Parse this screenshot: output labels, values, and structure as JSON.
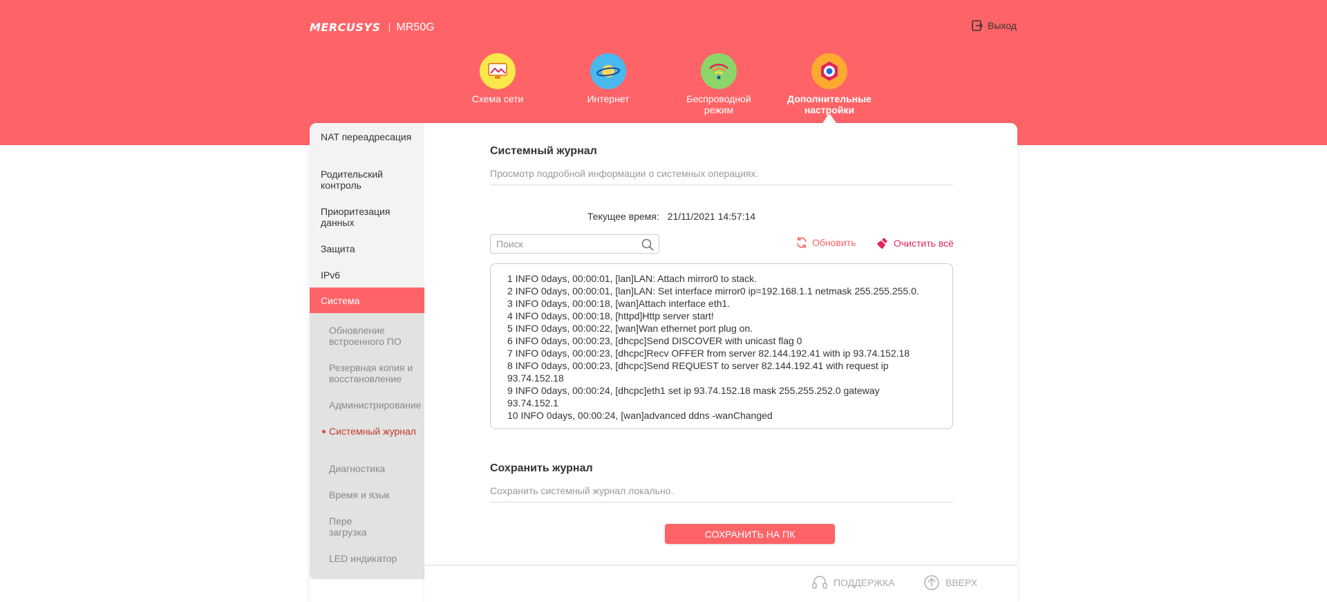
{
  "header": {
    "brand": "MERCUSYS",
    "model": "MR50G",
    "logout_label": "Выход"
  },
  "nav": {
    "items": [
      {
        "label": "Схема сети",
        "icon": "network-map-icon",
        "color": "#fce84b"
      },
      {
        "label": "Интернет",
        "icon": "planet-icon",
        "color": "#49b8ee"
      },
      {
        "label": "Беспроводной режим",
        "icon": "wifi-icon",
        "color": "#8bd668"
      },
      {
        "label": "Дополнительные настройки",
        "icon": "gear-icon",
        "color": "#ffa930"
      }
    ],
    "active_index": 3
  },
  "sidebar": {
    "items": [
      {
        "label": "NAT переадресация"
      },
      {
        "label": "Родительский контроль"
      },
      {
        "label": "Приоритезация данных"
      },
      {
        "label": "Защита"
      },
      {
        "label": "IPv6"
      },
      {
        "label": "Система"
      }
    ],
    "sub_items": [
      {
        "label": "Обновление встроенного ПО"
      },
      {
        "label": "Резервная копия и восстановление"
      },
      {
        "label": "Администрирование"
      },
      {
        "label": "Системный журнал"
      },
      {
        "label": "Диагностика"
      },
      {
        "label": "Время и язык"
      },
      {
        "label": "Пере загрузка"
      },
      {
        "label": "LED индикатор"
      }
    ]
  },
  "syslog": {
    "title": "Системный журнал",
    "description": "Просмотр подробной информации о системных операциях.",
    "time_label": "Текущее время:",
    "time_value": "21/11/2021 14:57:14",
    "search_placeholder": "Поиск",
    "refresh_label": "Обновить",
    "clear_label": "Очистить всё",
    "lines": [
      "1 INFO 0days, 00:00:01, [lan]LAN: Attach mirror0 to stack.",
      "2 INFO 0days, 00:00:01, [lan]LAN: Set interface mirror0 ip=192.168.1.1 netmask 255.255.255.0.",
      "3 INFO 0days, 00:00:18, [wan]Attach interface eth1.",
      "4 INFO 0days, 00:00:18, [httpd]Http server start!",
      "5 INFO 0days, 00:00:22, [wan]Wan ethernet port plug on.",
      "6 INFO 0days, 00:00:23, [dhcpc]Send DISCOVER with unicast flag 0",
      "7 INFO 0days, 00:00:23, [dhcpc]Recv OFFER from server 82.144.192.41 with ip 93.74.152.18",
      "8 INFO 0days, 00:00:23, [dhcpc]Send REQUEST to server 82.144.192.41 with request ip 93.74.152.18",
      "9 INFO 0days, 00:00:24, [dhcpc]eth1 set ip 93.74.152.18 mask 255.255.252.0 gateway 93.74.152.1",
      "10 INFO 0days, 00:00:24, [wan]advanced ddns -wanChanged"
    ]
  },
  "save_log": {
    "title": "Сохранить журнал",
    "description": "Сохранить системный журнал локально.",
    "button_label": "СОХРАНИТЬ НА ПК"
  },
  "footer": {
    "support_label": "ПОДДЕРЖКА",
    "up_label": "ВВЕРХ"
  },
  "colors": {
    "accent": "#fe6467",
    "clear_accent": "#e0245e"
  }
}
